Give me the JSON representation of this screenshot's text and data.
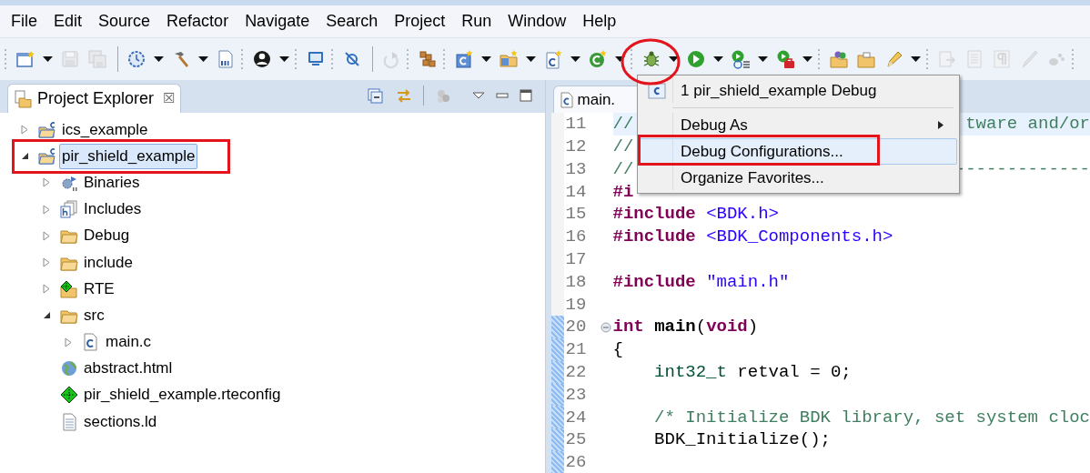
{
  "menu_bar": [
    "File",
    "Edit",
    "Source",
    "Refactor",
    "Navigate",
    "Search",
    "Project",
    "Run",
    "Window",
    "Help"
  ],
  "toolbar": [
    {
      "kind": "grip"
    },
    {
      "kind": "button",
      "disabled": false,
      "dropdown": true
    },
    {
      "kind": "button",
      "disabled": true,
      "dropdown": false
    },
    {
      "kind": "button",
      "disabled": true,
      "dropdown": false
    },
    {
      "kind": "separator"
    },
    {
      "kind": "button",
      "disabled": false,
      "dropdown": true
    },
    {
      "kind": "button",
      "disabled": false,
      "dropdown": true
    },
    {
      "kind": "button",
      "disabled": false,
      "dropdown": false
    },
    {
      "kind": "grip"
    },
    {
      "kind": "button",
      "disabled": false,
      "dropdown": true
    },
    {
      "kind": "grip"
    },
    {
      "kind": "button",
      "disabled": false,
      "dropdown": false
    },
    {
      "kind": "grip"
    },
    {
      "kind": "button",
      "disabled": false,
      "dropdown": false
    },
    {
      "kind": "separator"
    },
    {
      "kind": "button",
      "disabled": true,
      "dropdown": false
    },
    {
      "kind": "grip"
    },
    {
      "kind": "button",
      "disabled": false,
      "dropdown": false
    },
    {
      "kind": "grip"
    },
    {
      "kind": "button",
      "disabled": false,
      "dropdown": true
    },
    {
      "kind": "button",
      "disabled": false,
      "dropdown": true
    },
    {
      "kind": "button",
      "disabled": false,
      "dropdown": true
    },
    {
      "kind": "button",
      "disabled": false,
      "dropdown": true
    },
    {
      "kind": "grip"
    },
    {
      "kind": "button",
      "disabled": false,
      "dropdown": true
    },
    {
      "kind": "button",
      "disabled": false,
      "dropdown": true
    },
    {
      "kind": "button",
      "disabled": false,
      "dropdown": true
    },
    {
      "kind": "button",
      "disabled": false,
      "dropdown": true
    },
    {
      "kind": "grip"
    },
    {
      "kind": "button",
      "disabled": false,
      "dropdown": false
    },
    {
      "kind": "button",
      "disabled": false,
      "dropdown": false
    },
    {
      "kind": "button",
      "disabled": false,
      "dropdown": true
    },
    {
      "kind": "grip"
    },
    {
      "kind": "button",
      "disabled": true,
      "dropdown": false
    },
    {
      "kind": "button",
      "disabled": true,
      "dropdown": false
    },
    {
      "kind": "button",
      "disabled": true,
      "dropdown": false
    },
    {
      "kind": "button",
      "disabled": true,
      "dropdown": false
    },
    {
      "kind": "button",
      "disabled": true,
      "dropdown": false
    },
    {
      "kind": "grip"
    }
  ],
  "project_explorer": {
    "title": "Project Explorer",
    "close": "☒",
    "tree": [
      {
        "label": "ics_example",
        "kind": "project",
        "expanded": false,
        "selected": false
      },
      {
        "label": "pir_shield_example",
        "kind": "project",
        "expanded": true,
        "selected": true,
        "children": [
          {
            "label": "Binaries",
            "kind": "binaries",
            "expanded": false,
            "selected": false
          },
          {
            "label": "Includes",
            "kind": "includes",
            "expanded": false,
            "selected": false
          },
          {
            "label": "Debug",
            "kind": "folder",
            "expanded": false,
            "selected": false
          },
          {
            "label": "include",
            "kind": "folder",
            "expanded": false,
            "selected": false
          },
          {
            "label": "RTE",
            "kind": "rte",
            "expanded": false,
            "selected": false
          },
          {
            "label": "src",
            "kind": "folder",
            "expanded": true,
            "selected": false,
            "children": [
              {
                "label": "main.c",
                "kind": "cfile",
                "expanded": false,
                "selected": false
              }
            ]
          },
          {
            "label": "abstract.html",
            "kind": "html",
            "selected": false
          },
          {
            "label": "pir_shield_example.rteconfig",
            "kind": "rteconfig",
            "selected": false
          },
          {
            "label": "sections.ld",
            "kind": "text",
            "selected": false
          }
        ]
      }
    ]
  },
  "editor": {
    "tab": "main.",
    "lines": [
      {
        "number": "11",
        "current": true,
        "changed": false,
        "tokens": [
          {
            "kind": "comment",
            "text": "//"
          }
        ],
        "tail": {
          "kind": "comment",
          "text": "tware and/or"
        }
      },
      {
        "number": "12",
        "current": false,
        "changed": false,
        "tokens": [
          {
            "kind": "comment",
            "text": "//"
          }
        ]
      },
      {
        "number": "13",
        "current": false,
        "changed": false,
        "tokens": [
          {
            "kind": "comment",
            "text": "//"
          }
        ],
        "tail": {
          "kind": "comment",
          "text": "-------------"
        }
      },
      {
        "number": "14",
        "current": false,
        "changed": false,
        "tokens": [
          {
            "kind": "keyword",
            "text": "#i"
          }
        ]
      },
      {
        "number": "15",
        "current": false,
        "changed": false,
        "tokens": [
          {
            "kind": "keyword",
            "text": "#include "
          },
          {
            "kind": "string",
            "text": "<BDK.h>"
          }
        ]
      },
      {
        "number": "16",
        "current": false,
        "changed": false,
        "tokens": [
          {
            "kind": "keyword",
            "text": "#include "
          },
          {
            "kind": "string",
            "text": "<BDK_Components.h>"
          }
        ]
      },
      {
        "number": "17",
        "current": false,
        "changed": false
      },
      {
        "number": "18",
        "current": false,
        "changed": false,
        "tokens": [
          {
            "kind": "keyword",
            "text": "#include "
          },
          {
            "kind": "string",
            "text": "\"main.h\""
          }
        ]
      },
      {
        "number": "19",
        "current": false,
        "changed": false
      },
      {
        "number": "20",
        "current": false,
        "changed": true,
        "foldable": true,
        "tokens": [
          {
            "kind": "keyword",
            "text": "int "
          },
          {
            "kind": "function",
            "text": "main"
          },
          {
            "kind": "plain",
            "text": "("
          },
          {
            "kind": "keyword",
            "text": "void"
          },
          {
            "kind": "plain",
            "text": ")"
          }
        ]
      },
      {
        "number": "21",
        "current": false,
        "changed": true,
        "tokens": [
          {
            "kind": "plain",
            "text": "{"
          }
        ]
      },
      {
        "number": "22",
        "current": false,
        "changed": true,
        "indented": true,
        "tokens": [
          {
            "kind": "type",
            "text": "int32_t"
          },
          {
            "kind": "plain",
            "text": " retval = 0;"
          }
        ]
      },
      {
        "number": "23",
        "current": false,
        "changed": true
      },
      {
        "number": "24",
        "current": false,
        "changed": true,
        "indented": true,
        "tokens": [
          {
            "kind": "comment",
            "text": "/* Initialize BDK library, set system cloc"
          }
        ]
      },
      {
        "number": "25",
        "current": false,
        "changed": true,
        "indented": true,
        "tokens": [
          {
            "kind": "plain",
            "text": "BDK_Initialize();"
          }
        ]
      },
      {
        "number": "26",
        "current": false,
        "changed": true
      }
    ]
  },
  "debug_menu": [
    {
      "kind": "launch",
      "label": "1 pir_shield_example Debug",
      "selected": false
    },
    {
      "kind": "separator"
    },
    {
      "kind": "submenu",
      "label": "Debug As",
      "selected": false
    },
    {
      "kind": "item",
      "label": "Debug Configurations...",
      "selected": true
    },
    {
      "kind": "item",
      "label": "Organize Favorites...",
      "selected": false
    }
  ]
}
